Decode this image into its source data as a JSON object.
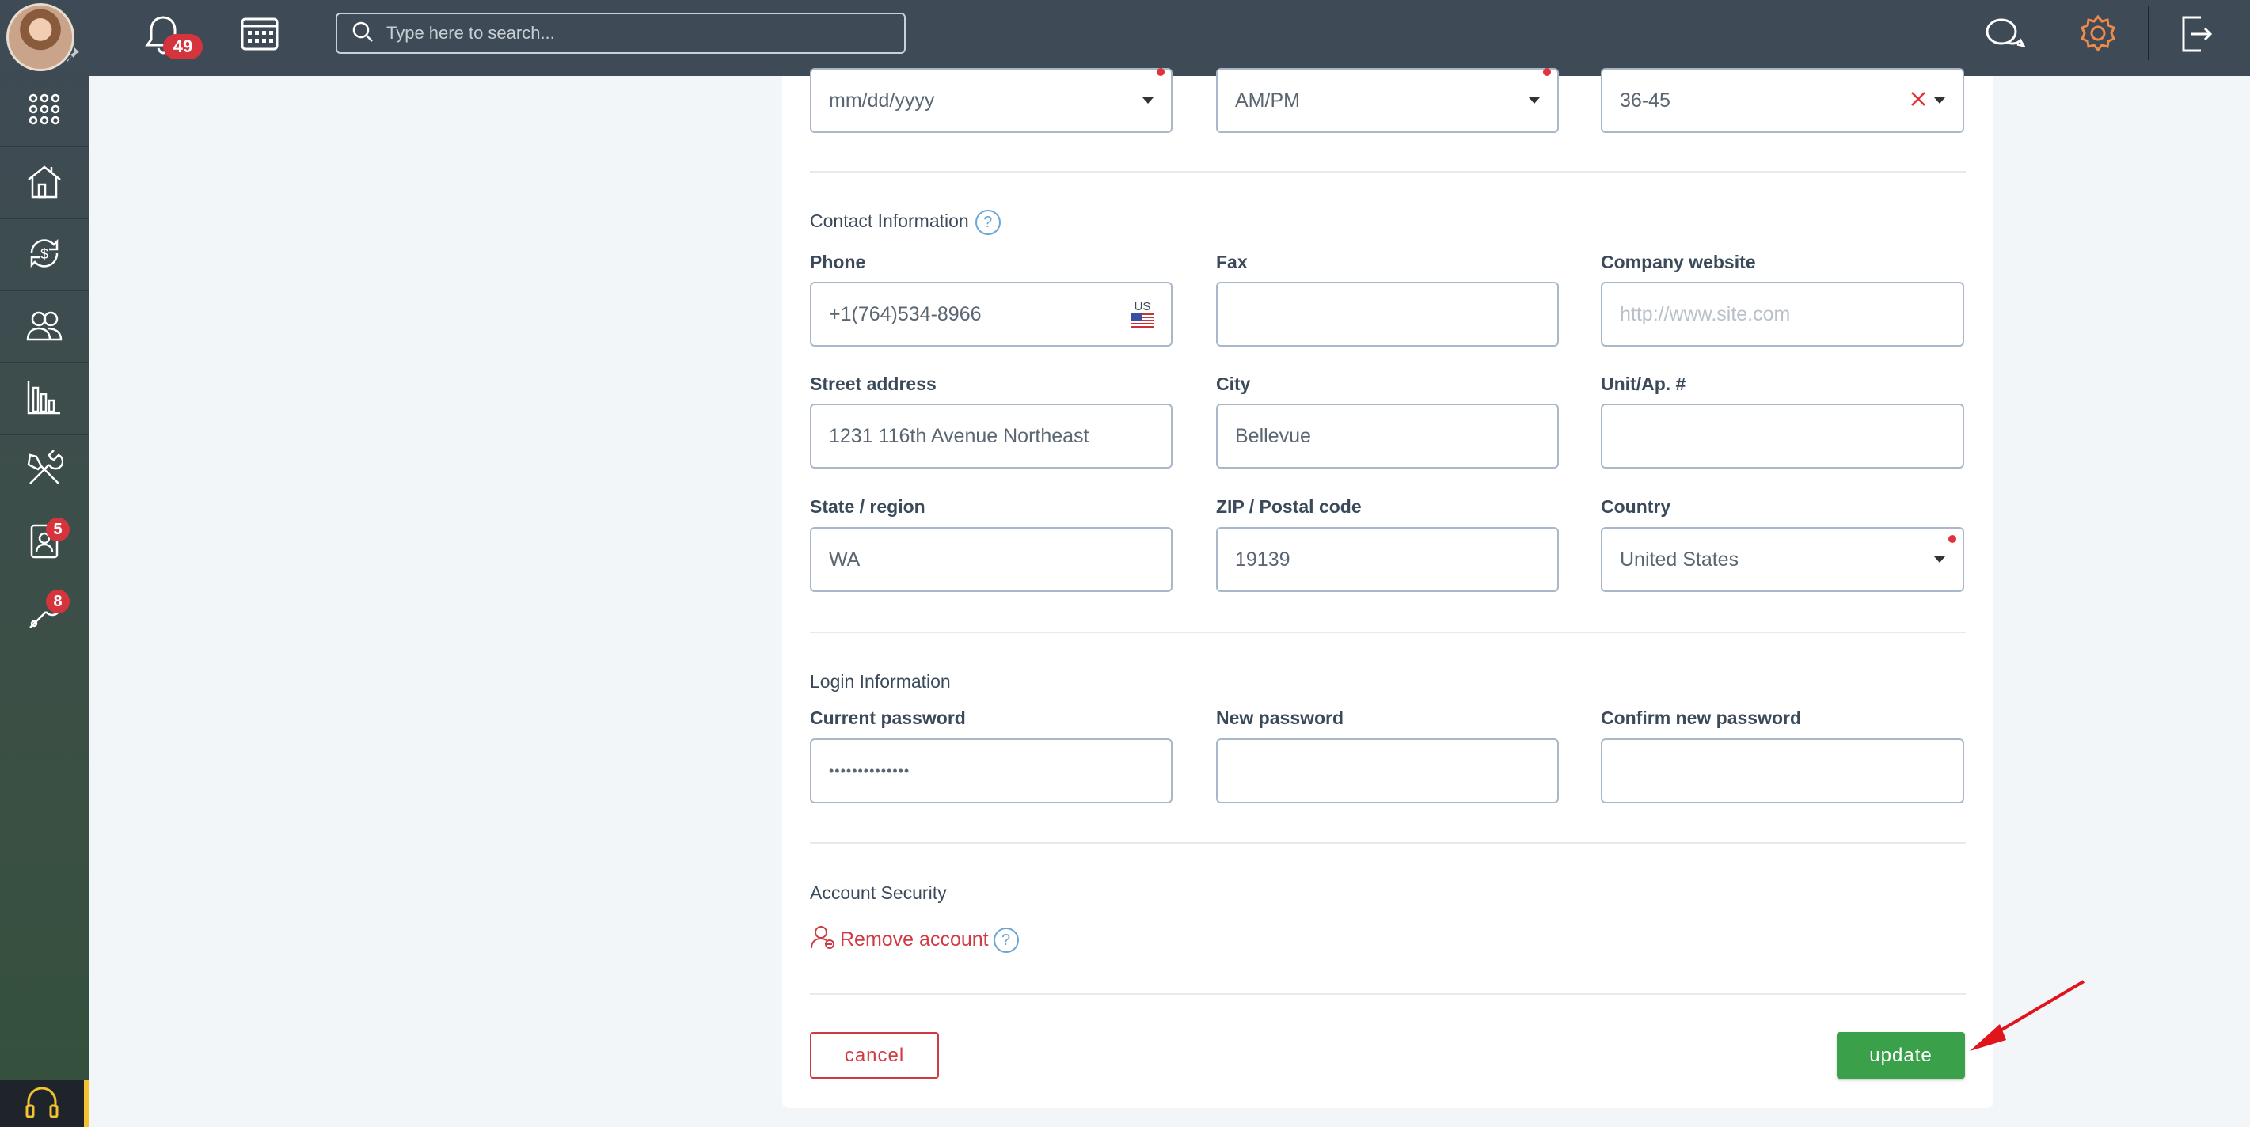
{
  "topbar": {
    "notification_count": "49",
    "search_placeholder": "Type here to search..."
  },
  "sidebar": {
    "items": [
      {
        "name": "apps",
        "icon": "grid-icon"
      },
      {
        "name": "home",
        "icon": "house-icon"
      },
      {
        "name": "payments",
        "icon": "dollar-cycle-icon"
      },
      {
        "name": "contacts",
        "icon": "users-icon"
      },
      {
        "name": "reports",
        "icon": "bar-chart-icon"
      },
      {
        "name": "tools",
        "icon": "tools-icon"
      },
      {
        "name": "tenant",
        "icon": "user-card-icon",
        "badge": "5"
      },
      {
        "name": "maintenance",
        "icon": "wrench-icon",
        "badge": "8"
      }
    ]
  },
  "form": {
    "top_row": {
      "date_value": "mm/dd/yyyy",
      "time_value": "AM/PM",
      "age_value": "36-45"
    },
    "contact": {
      "title": "Contact Information",
      "help": "?",
      "phone_label": "Phone",
      "phone_value": "+1(764)534-8966",
      "phone_country": "US",
      "fax_label": "Fax",
      "fax_value": "",
      "website_label": "Company website",
      "website_placeholder": "http://www.site.com",
      "street_label": "Street address",
      "street_value": "1231 116th Avenue Northeast",
      "city_label": "City",
      "city_value": "Bellevue",
      "unit_label": "Unit/Ap. #",
      "unit_value": "",
      "state_label": "State / region",
      "state_value": "WA",
      "zip_label": "ZIP / Postal code",
      "zip_value": "19139",
      "country_label": "Country",
      "country_value": "United States"
    },
    "login": {
      "title": "Login Information",
      "current_label": "Current password",
      "current_value": "••••••••••••••",
      "new_label": "New password",
      "confirm_label": "Confirm new password"
    },
    "security": {
      "title": "Account Security",
      "remove_label": "Remove account",
      "help": "?"
    },
    "buttons": {
      "cancel": "cancel",
      "update": "update"
    }
  },
  "colors": {
    "accent_red": "#d03a42",
    "accent_green": "#3aa14a",
    "topbar": "#3e4a55",
    "settings_icon": "#f08a4b"
  }
}
